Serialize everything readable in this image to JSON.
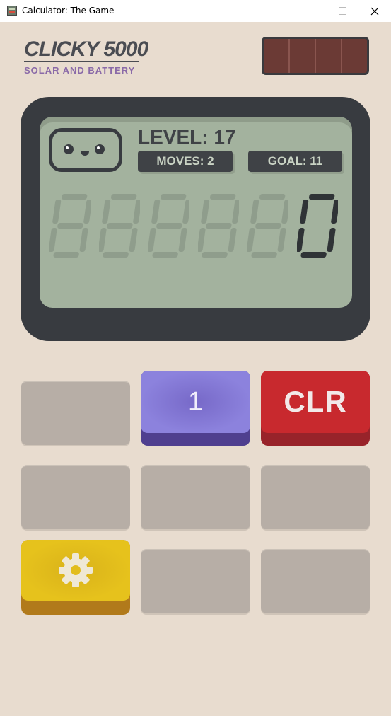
{
  "window": {
    "title": "Calculator: The Game",
    "minimize_icon": "minimize-icon",
    "maximize_icon": "maximize-icon",
    "close_icon": "close-icon"
  },
  "brand": {
    "name": "CLICKY 5000",
    "subtitle": "SOLAR AND BATTERY"
  },
  "display": {
    "level": "LEVEL: 17",
    "moves": "MOVES: 2",
    "goal": "GOAL: 11",
    "value": "0",
    "face_icon": "happy-robot-face-icon"
  },
  "keys": [
    {
      "id": "key-1",
      "label": "",
      "state": "blank"
    },
    {
      "id": "key-2",
      "label": "1",
      "color": "#8c82dd"
    },
    {
      "id": "key-3",
      "label": "CLR",
      "color": "#c8292e"
    },
    {
      "id": "key-4",
      "label": "",
      "state": "blank"
    },
    {
      "id": "key-5",
      "label": "",
      "state": "blank"
    },
    {
      "id": "key-6",
      "label": "",
      "state": "blank"
    },
    {
      "id": "key-7",
      "label": "",
      "icon": "gear-icon",
      "color": "#e6c21c"
    },
    {
      "id": "key-8",
      "label": "",
      "state": "blank"
    },
    {
      "id": "key-9",
      "label": "",
      "state": "blank"
    }
  ],
  "colors": {
    "background": "#e8dccf",
    "screen_frame": "#383b40",
    "lcd": "#a3b29e",
    "solar_panel": "#6b3a35"
  }
}
